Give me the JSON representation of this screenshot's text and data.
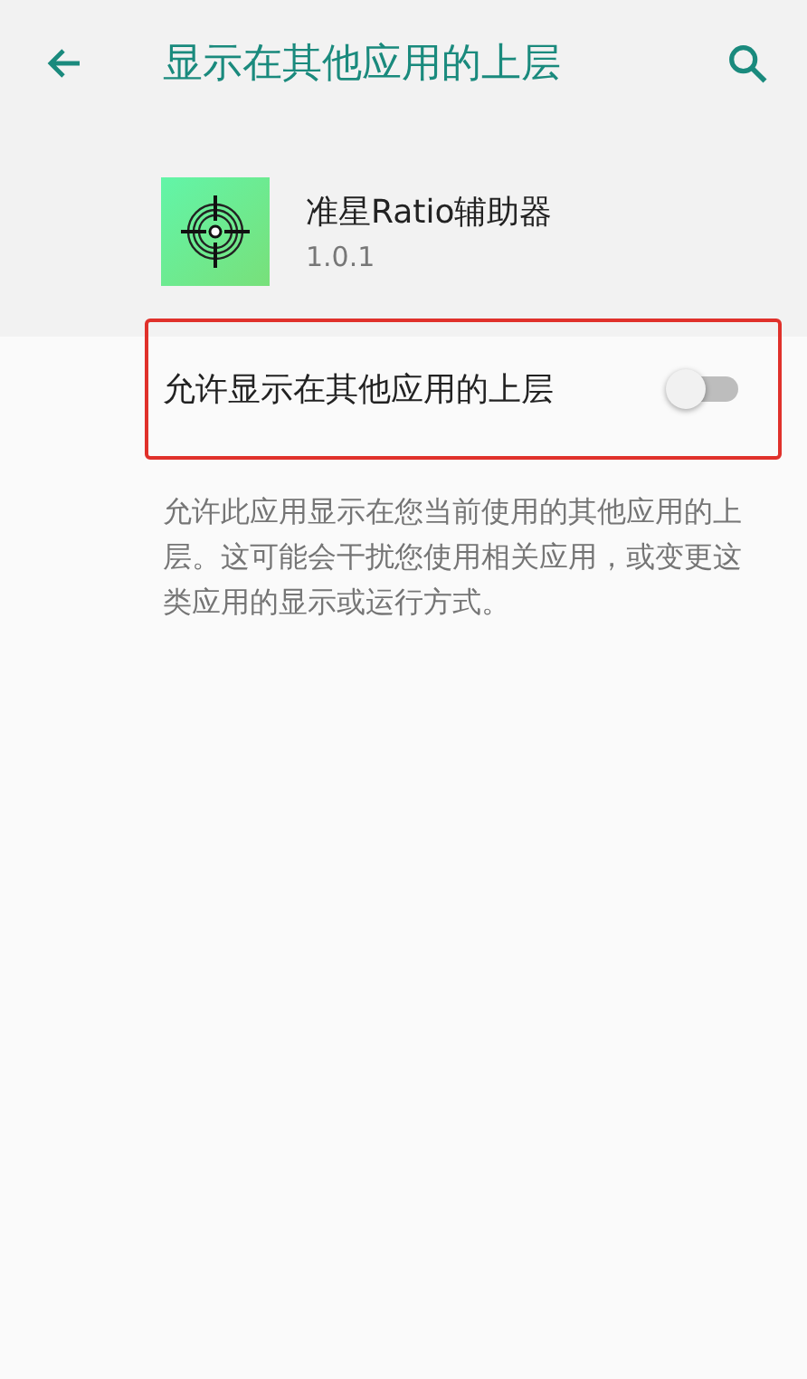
{
  "header": {
    "title": "显示在其他应用的上层"
  },
  "app": {
    "name": "准星Ratio辅助器",
    "version": "1.0.1"
  },
  "setting": {
    "label": "允许显示在其他应用的上层",
    "on": false,
    "highlighted": true
  },
  "description": "允许此应用显示在您当前使用的其他应用的上层。这可能会干扰您使用相关应用，或变更这类应用的显示或运行方式。"
}
